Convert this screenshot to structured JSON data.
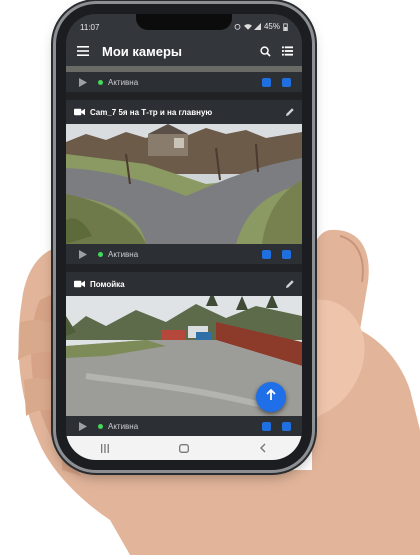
{
  "status_bar": {
    "time": "11:07",
    "battery": "45%"
  },
  "app_bar": {
    "title": "Мои камеры",
    "icons": [
      "menu-icon",
      "search-icon",
      "list-view-icon"
    ]
  },
  "cameras": [
    {
      "name": "",
      "status": "Активна"
    },
    {
      "name": "Cam_7 5я на Т-тр и на главную",
      "status": "Активна"
    },
    {
      "name": "Помойка",
      "status": "Активна"
    }
  ],
  "fab": {
    "icon": "arrow-up-icon"
  },
  "nav_bar": {
    "icons": [
      "recents-icon",
      "home-icon",
      "back-icon"
    ]
  },
  "colors": {
    "accent": "#1e6fe8",
    "status_active": "#43d95b",
    "app_bar": "#33363b",
    "card": "#2c2f33"
  }
}
